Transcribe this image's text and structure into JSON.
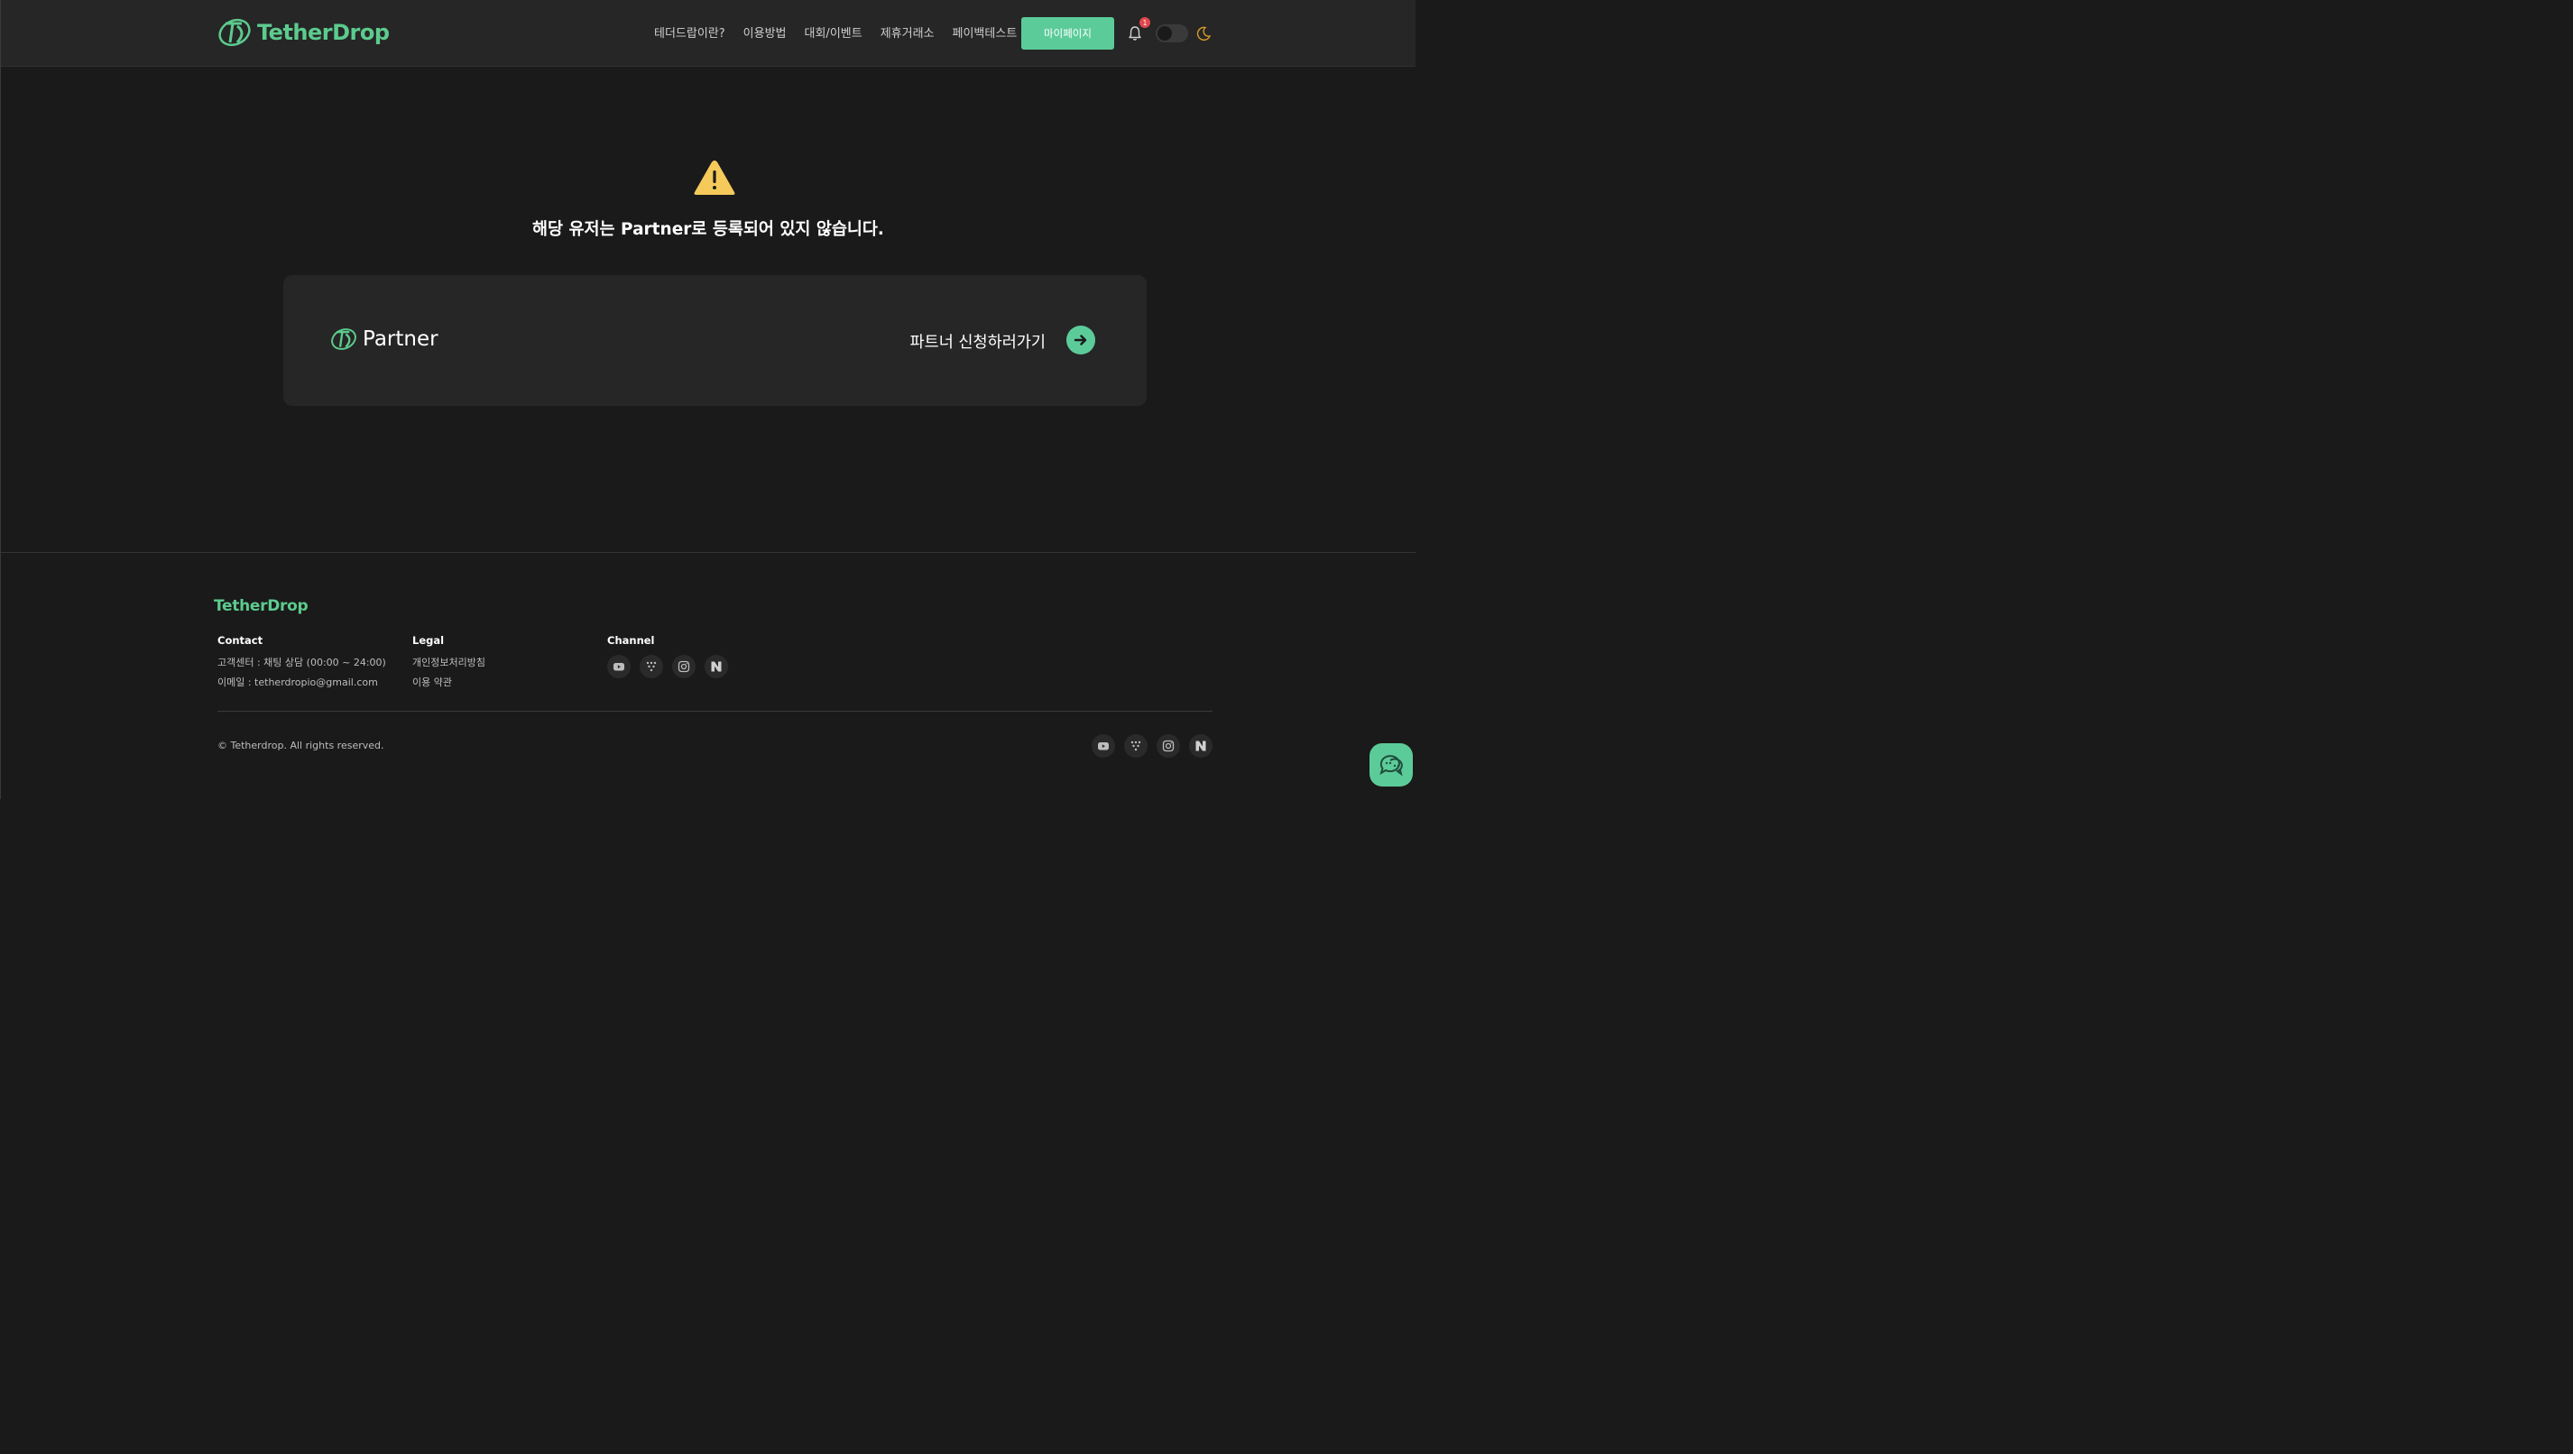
{
  "header": {
    "logo_text": "TetherDrop",
    "nav": [
      "테더드랍이란?",
      "이용방법",
      "대회/이벤트",
      "제휴거래소",
      "페이백테스트"
    ],
    "mypage_label": "마이페이지",
    "notification_count": "1"
  },
  "main": {
    "message": "해당 유저는 Partner로 등록되어 있지 않습니다.",
    "partner_label": "Partner",
    "apply_label": "파트너 신청하러가기"
  },
  "footer": {
    "logo_text": "TetherDrop",
    "contact": {
      "heading": "Contact",
      "line1": "고객센터 : 채팅 상담 (00:00 ~ 24:00)",
      "line2": "이메일 : tetherdropio@gmail.com"
    },
    "legal": {
      "heading": "Legal",
      "privacy": "개인정보처리방침",
      "terms": "이용 약관"
    },
    "channel": {
      "heading": "Channel",
      "icons": [
        "youtube-icon",
        "telegram-dots-icon",
        "instagram-icon",
        "naver-icon"
      ]
    },
    "copyright": "© Tetherdrop. All rights reserved."
  },
  "colors": {
    "accent": "#5ccb9a",
    "logo_green": "#5ccb8e",
    "background": "#1a1a1a",
    "header_bg": "#262626",
    "warning": "#f5c95a",
    "badge": "#e0474c"
  }
}
